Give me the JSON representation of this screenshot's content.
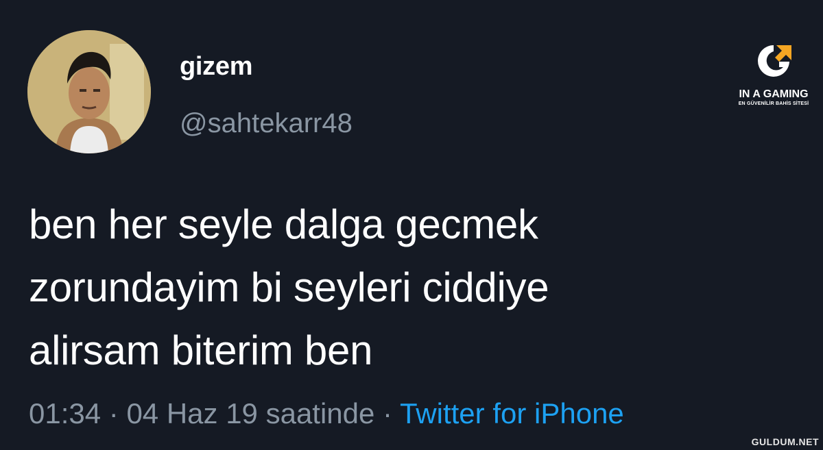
{
  "tweet": {
    "display_name": "gizem",
    "handle": "@sahtekarr48",
    "text_lines": [
      "ben her seyle dalga gecmek",
      "zorundayim bi seyleri ciddiye",
      "alirsam biterim ben"
    ],
    "time": "01:34",
    "separator": "·",
    "date": "04 Haz 19 saatinde",
    "source": "Twitter for iPhone"
  },
  "brand": {
    "name": "IN A GAMING",
    "tagline": "EN GÜVENİLİR BAHİS SİTESİ"
  },
  "watermark": "GULDUM.NET",
  "colors": {
    "background": "#151a24",
    "text": "#ffffff",
    "muted": "#8a96a3",
    "link": "#1da1f2",
    "logo_accent": "#f5a623"
  },
  "icons": {
    "avatar": "user-avatar-photo",
    "brand": "brand-logo-icon"
  }
}
